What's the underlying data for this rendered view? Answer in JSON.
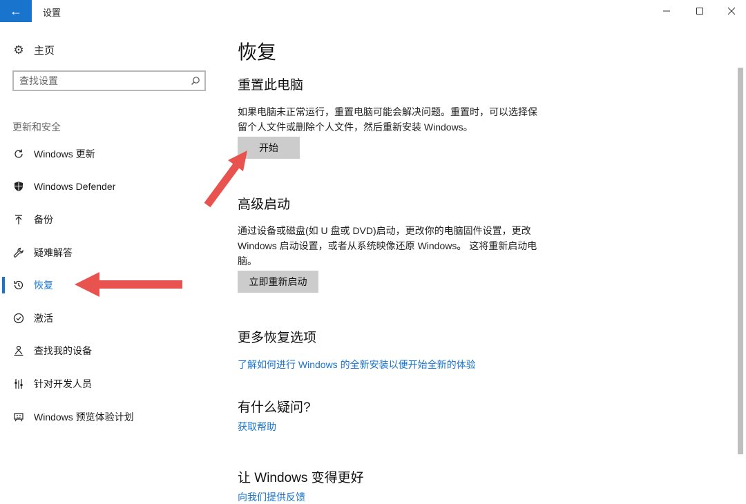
{
  "window": {
    "title": "设置",
    "back_glyph": "←",
    "min_glyph": "—",
    "max_glyph": "☐",
    "close_glyph": "✕"
  },
  "sidebar": {
    "home_label": "主页",
    "search_placeholder": "查找设置",
    "section_title": "更新和安全",
    "items": [
      {
        "label": "Windows 更新",
        "icon": "refresh-icon"
      },
      {
        "label": "Windows Defender",
        "icon": "shield-icon"
      },
      {
        "label": "备份",
        "icon": "upload-icon"
      },
      {
        "label": "疑难解答",
        "icon": "wrench-icon"
      },
      {
        "label": "恢复",
        "icon": "history-icon",
        "active": true
      },
      {
        "label": "激活",
        "icon": "check-circle-icon"
      },
      {
        "label": "查找我的设备",
        "icon": "person-pin-icon"
      },
      {
        "label": "针对开发人员",
        "icon": "developer-icon"
      },
      {
        "label": "Windows 预览体验计划",
        "icon": "smiley-icon"
      }
    ]
  },
  "main": {
    "title": "恢复",
    "reset": {
      "heading": "重置此电脑",
      "description": "如果电脑未正常运行，重置电脑可能会解决问题。重置时，可以选择保留个人文件或删除个人文件，然后重新安装 Windows。",
      "button": "开始"
    },
    "advanced": {
      "heading": "高级启动",
      "description": "通过设备或磁盘(如 U 盘或 DVD)启动，更改你的电脑固件设置，更改 Windows 启动设置，或者从系统映像还原 Windows。 这将重新启动电脑。",
      "button": "立即重新启动"
    },
    "more": {
      "heading": "更多恢复选项",
      "link": "了解如何进行 Windows 的全新安装以便开始全新的体验"
    },
    "questions": {
      "heading": "有什么疑问?",
      "link": "获取帮助"
    },
    "better": {
      "heading": "让 Windows 变得更好",
      "link": "向我们提供反馈"
    }
  },
  "colors": {
    "accent": "#1874cd",
    "annotation_arrow": "#e8524f",
    "button_bg": "#cccccc"
  }
}
